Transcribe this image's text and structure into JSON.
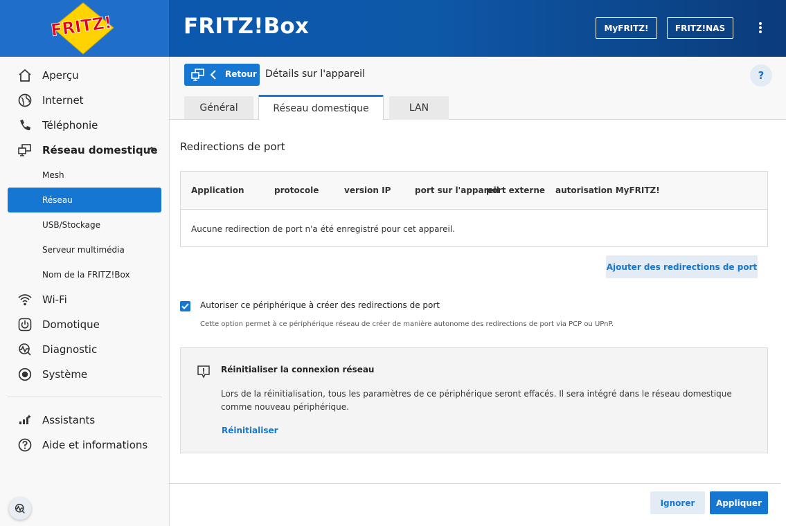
{
  "header": {
    "title": "FRITZ!Box",
    "logo_text": "FRITZ!",
    "buttons": [
      "MyFRITZ!",
      "FRITZ!NAS"
    ]
  },
  "sidebar": {
    "items": [
      {
        "label": "Aperçu",
        "icon": "home-icon"
      },
      {
        "label": "Internet",
        "icon": "globe-icon"
      },
      {
        "label": "Téléphonie",
        "icon": "phone-icon"
      },
      {
        "label": "Réseau domestique",
        "icon": "network-icon",
        "expanded": true
      },
      {
        "label": "Wi-Fi",
        "icon": "wifi-icon"
      },
      {
        "label": "Domotique",
        "icon": "power-icon"
      },
      {
        "label": "Diagnostic",
        "icon": "diagnostic-icon"
      },
      {
        "label": "Système",
        "icon": "system-icon"
      },
      {
        "label": "Assistants",
        "icon": "wizard-icon"
      },
      {
        "label": "Aide et informations",
        "icon": "help-icon"
      }
    ],
    "subitems": [
      {
        "label": "Mesh"
      },
      {
        "label": "Réseau",
        "active": true
      },
      {
        "label": "USB/Stockage"
      },
      {
        "label": "Serveur multimédia"
      },
      {
        "label": "Nom de la FRITZ!Box"
      }
    ]
  },
  "content": {
    "back_label": "Retour",
    "page_title": "Détails sur l'appareil",
    "help_label": "?",
    "tabs": [
      {
        "label": "Général"
      },
      {
        "label": "Réseau domestique",
        "active": true
      },
      {
        "label": "LAN"
      }
    ],
    "section_title": "Redirections de port",
    "table": {
      "columns": [
        "Application",
        "protocole",
        "version IP",
        "port sur l'appareil",
        "port externe",
        "autorisation MyFRITZ!"
      ],
      "empty_text": "Aucune redirection de port n'a été enregistré pour cet appareil."
    },
    "add_button": "Ajouter des redirections de port",
    "checkbox": {
      "checked": true,
      "label": "Autoriser ce périphérique à créer des redirections de port",
      "hint": "Cette option permet à ce périphérique réseau de créer de manière autonome des redirections de port via PCP ou UPnP."
    },
    "reset": {
      "title": "Réinitialiser la connexion réseau",
      "text": "Lors de la réinitialisation, tous les paramètres de ce périphérique seront effacés. Il sera intégré dans le réseau domestique comme nouveau périphérique.",
      "link": "Réinitialiser"
    }
  },
  "footer": {
    "ignore": "Ignorer",
    "apply": "Appliquer"
  },
  "colors": {
    "accent": "#1577d2",
    "header": "#0e58a8",
    "logo_red": "#e2001a",
    "logo_yellow": "#ffd300"
  }
}
